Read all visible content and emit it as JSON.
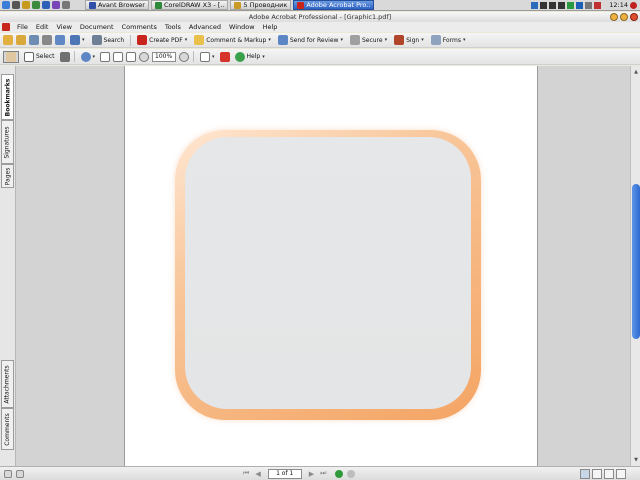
{
  "taskbar": {
    "tasks": [
      {
        "label": "Avant Browser",
        "color": "#2f4fa8"
      },
      {
        "label": "CorelDRAW X3 - [..",
        "color": "#2c8a3a"
      },
      {
        "label": "5 Проводник",
        "color": "#c99a28"
      },
      {
        "label": "Adobe Acrobat Pro..",
        "color": "#c8251d"
      }
    ],
    "clock": "12:14"
  },
  "window": {
    "title": "Adobe Acrobat Professional - [Graphic1.pdf]"
  },
  "menu": {
    "items": [
      "File",
      "Edit",
      "View",
      "Document",
      "Comments",
      "Tools",
      "Advanced",
      "Window",
      "Help"
    ]
  },
  "toolbar1": {
    "search_label": "Search",
    "create_pdf_label": "Create PDF",
    "comment_markup_label": "Comment & Markup",
    "send_review_label": "Send for Review",
    "secure_label": "Secure",
    "sign_label": "Sign",
    "forms_label": "Forms"
  },
  "toolbar2": {
    "select_label": "Select",
    "zoom_value": "100%",
    "help_label": "Help"
  },
  "sidenav": {
    "bookmarks": "Bookmarks",
    "signatures": "Signatures",
    "pages": "Pages",
    "attachments": "Attachments",
    "comments": "Comments"
  },
  "status": {
    "page_indicator": "1 of 1"
  }
}
